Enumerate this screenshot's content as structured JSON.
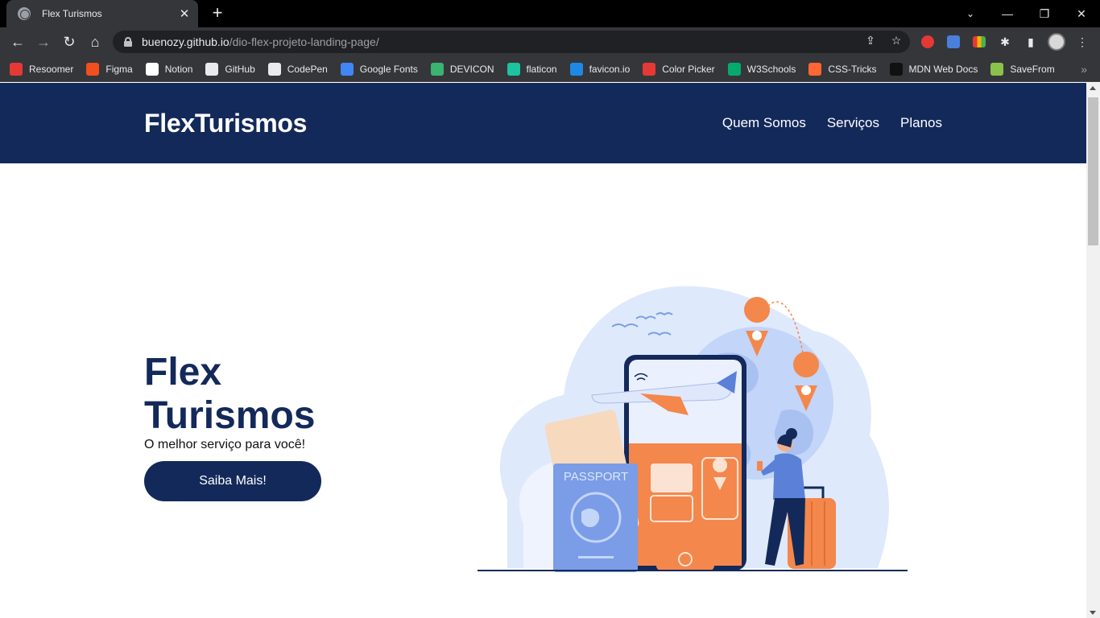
{
  "browser": {
    "tab_title": "Flex Turismos",
    "tab_close": "✕",
    "new_tab": "+",
    "url_host": "buenozy.github.io",
    "url_path": "/dio-flex-projeto-landing-page/",
    "bookmarks": [
      {
        "label": "Resoomer",
        "color": "#e53935"
      },
      {
        "label": "Figma",
        "color": "#f24e1e"
      },
      {
        "label": "Notion",
        "color": "#ffffff"
      },
      {
        "label": "GitHub",
        "color": "#e8eaed"
      },
      {
        "label": "CodePen",
        "color": "#e8eaed"
      },
      {
        "label": "Google Fonts",
        "color": "#4285f4"
      },
      {
        "label": "DEVICON",
        "color": "#3cb371"
      },
      {
        "label": "flaticon",
        "color": "#1dc29f"
      },
      {
        "label": "favicon.io",
        "color": "#1e88e5"
      },
      {
        "label": "Color Picker",
        "color": "#e53935"
      },
      {
        "label": "W3Schools",
        "color": "#04aa6d"
      },
      {
        "label": "CSS-Tricks",
        "color": "#ff6633"
      },
      {
        "label": "MDN Web Docs",
        "color": "#111111"
      },
      {
        "label": "SaveFrom",
        "color": "#8bc34a"
      }
    ]
  },
  "site": {
    "brand": "FlexTurismos",
    "nav": [
      "Quem Somos",
      "Serviços",
      "Planos"
    ],
    "hero": {
      "title": "Flex Turismos",
      "subtitle": "O melhor serviço para você!",
      "cta": "Saiba Mais!"
    },
    "illustration": {
      "passport_label": "PASSPORT"
    }
  },
  "colors": {
    "brand_navy": "#13295a",
    "accent_orange": "#f4874b",
    "light_blue": "#dbe6fb"
  }
}
